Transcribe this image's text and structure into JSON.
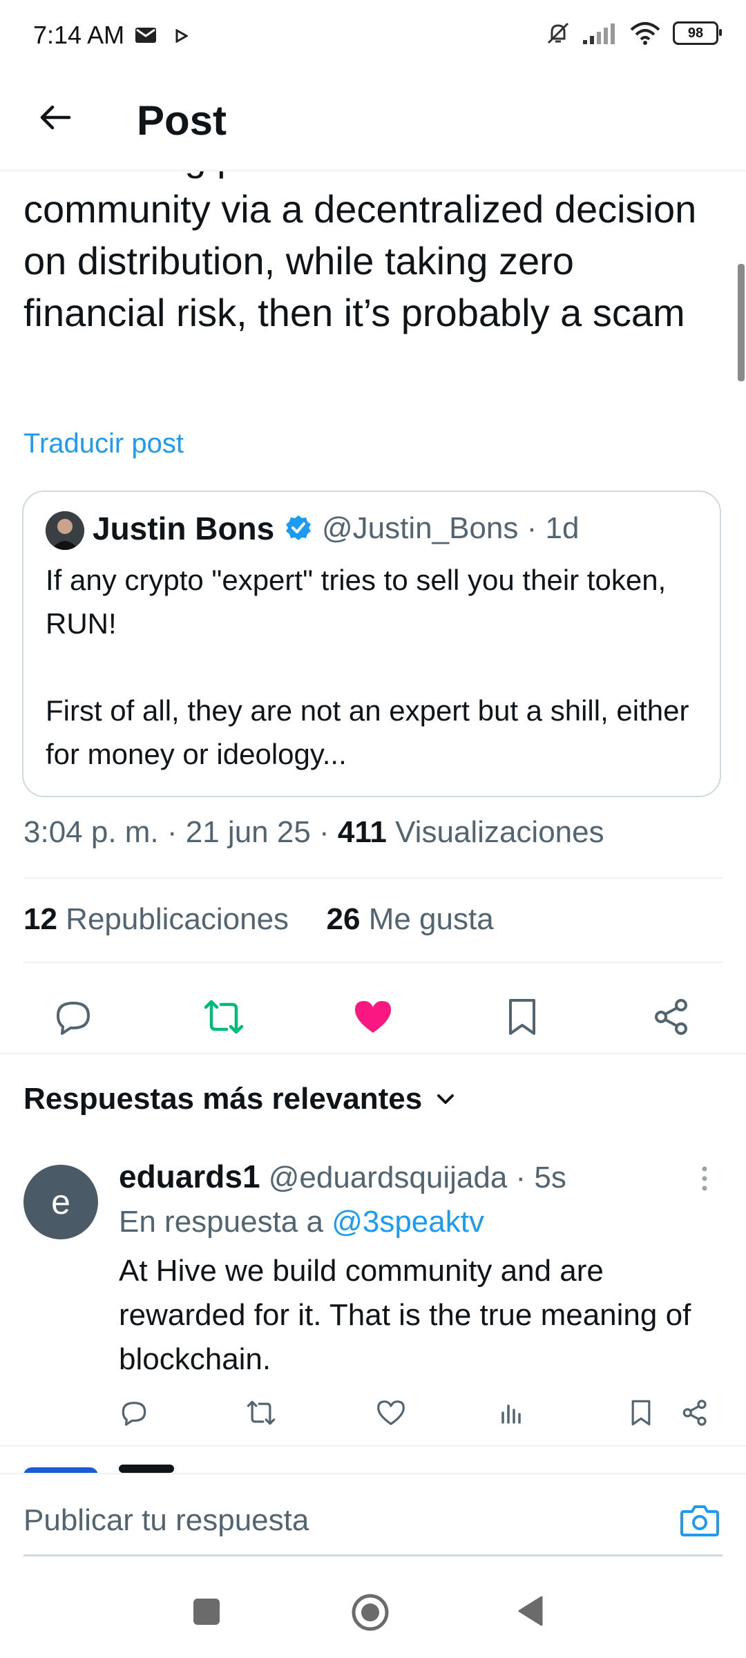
{
  "status_bar": {
    "time": "7:14 AM",
    "battery": "98",
    "icons": [
      "mail-icon",
      "play-icon",
      "mute-icon",
      "signal-icon",
      "wifi-icon",
      "battery-icon"
    ]
  },
  "header": {
    "title": "Post",
    "back_icon": "arrow-left-icon"
  },
  "post": {
    "text": "from doing positive actions for a community via a decentralized decision on distribution, while taking zero financial risk, then it’s probably a scam",
    "translate_label": "Traducir post",
    "quote": {
      "name": "Justin Bons",
      "handle_time": "@Justin_Bons · 1d",
      "text": "If any crypto \"expert\" tries to sell you their token, RUN!\n\nFirst of all, they are not an expert but a shill, either for money or ideology..."
    },
    "time": "3:04 p. m. · 21 jun 25 · ",
    "views_count": "411",
    "views_label": " Visualizaciones",
    "reposts_count": "12",
    "reposts_label": " Republicaciones",
    "likes_count": "26",
    "likes_label": " Me gusta"
  },
  "actions": [
    "reply-icon",
    "repost-icon",
    "like-icon",
    "bookmark-icon",
    "share-icon"
  ],
  "colors": {
    "accent": "#1d9bf0",
    "repost": "#00ba7c",
    "like": "#f91880",
    "muted": "#536471",
    "text": "#0f1419"
  },
  "replies": {
    "sort_label": "Respuestas más relevantes",
    "items": [
      {
        "avatar_letter": "e",
        "name": "eduards1",
        "handle_time": " @eduardsquijada · 5s",
        "reply_to_label": "En respuesta a ",
        "reply_to_handle": "@3speaktv",
        "text": "At Hive we build community and are rewarded for it. That is the true meaning of blockchain."
      }
    ]
  },
  "compose": {
    "placeholder": "Publicar tu respuesta"
  }
}
